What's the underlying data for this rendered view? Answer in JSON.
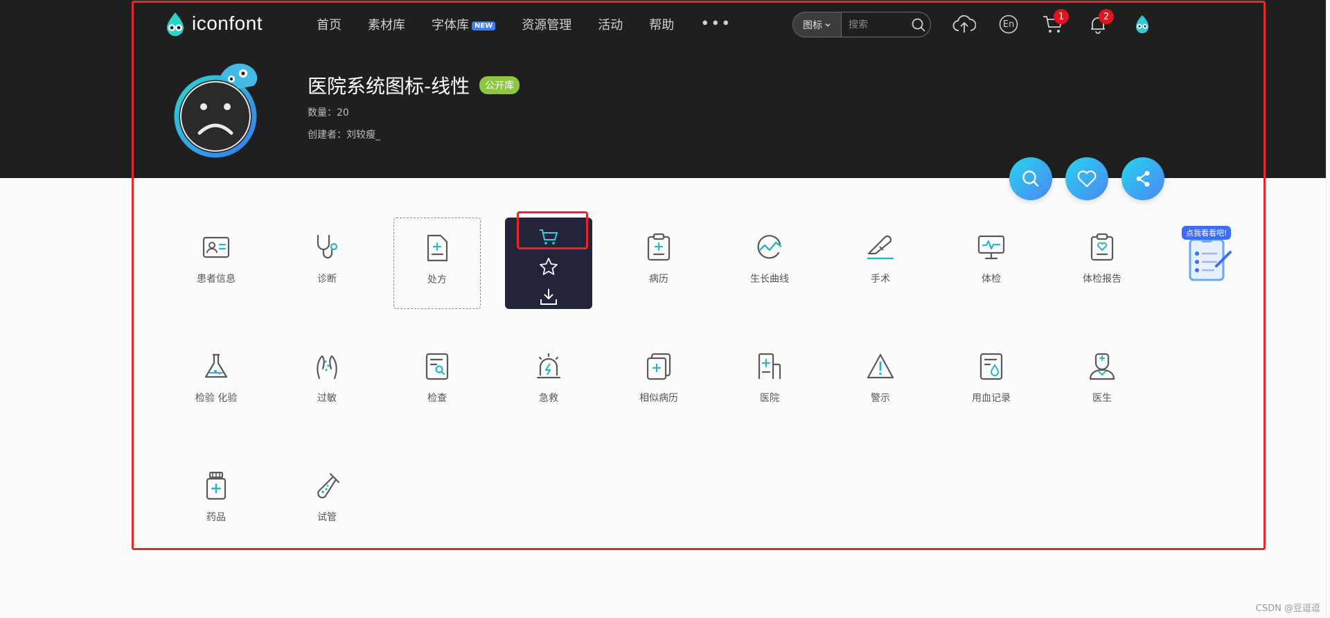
{
  "nav": {
    "logo_text": "iconfont",
    "items": [
      {
        "label": "首页"
      },
      {
        "label": "素材库"
      },
      {
        "label": "字体库",
        "badge": "NEW"
      },
      {
        "label": "资源管理"
      },
      {
        "label": "活动"
      },
      {
        "label": "帮助"
      }
    ],
    "more": "•••",
    "search": {
      "type": "图标",
      "placeholder": "搜索"
    },
    "cart_count": "1",
    "notify_count": "2",
    "lang": "En"
  },
  "collection": {
    "title": "医院系统图标-线性",
    "tag": "公开库",
    "count_line": "数量：20",
    "creator_line": "创建者：刘较瘦_"
  },
  "icons": [
    {
      "label": "患者信息",
      "icon": "id-card-icon"
    },
    {
      "label": "诊断",
      "icon": "stethoscope-icon"
    },
    {
      "label": "处方",
      "icon": "prescription-icon"
    },
    {
      "label": "",
      "icon": "hovered-icon"
    },
    {
      "label": "病历",
      "icon": "medical-record-icon"
    },
    {
      "label": "生长曲线",
      "icon": "growth-curve-icon"
    },
    {
      "label": "手术",
      "icon": "scalpel-icon"
    },
    {
      "label": "体检",
      "icon": "monitor-icon"
    },
    {
      "label": "体检报告",
      "icon": "report-icon"
    },
    {
      "label": "检验 化验",
      "icon": "flask-icon"
    },
    {
      "label": "过敏",
      "icon": "allergy-icon"
    },
    {
      "label": "检查",
      "icon": "inspect-icon"
    },
    {
      "label": "急救",
      "icon": "alarm-icon"
    },
    {
      "label": "相似病历",
      "icon": "similar-record-icon"
    },
    {
      "label": "医院",
      "icon": "hospital-icon"
    },
    {
      "label": "警示",
      "icon": "warning-icon"
    },
    {
      "label": "用血记录",
      "icon": "blood-record-icon"
    },
    {
      "label": "医生",
      "icon": "doctor-icon"
    },
    {
      "label": "药品",
      "icon": "medicine-icon"
    },
    {
      "label": "试管",
      "icon": "test-tube-icon"
    }
  ],
  "promo": {
    "label": "点我看看吧!"
  },
  "watermark": "CSDN @豆逗逗",
  "colors": {
    "header_bg": "#1f1f1f",
    "accent": "#26b6c8",
    "tag_green": "#8dc63f",
    "annotation_red": "#e8262a",
    "badge_red": "#e3121c"
  }
}
